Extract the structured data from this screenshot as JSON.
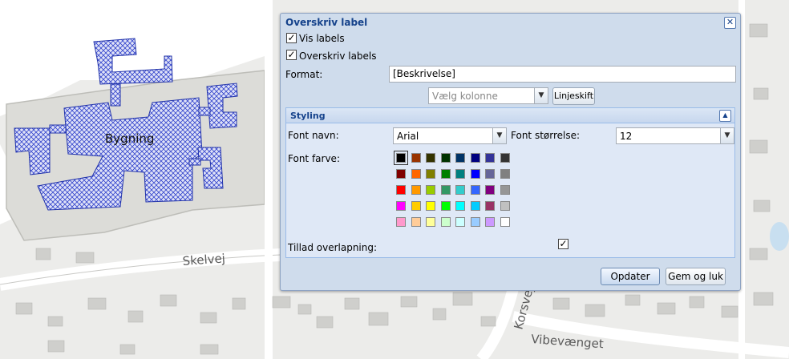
{
  "map": {
    "building_label": "Bygning",
    "roads": [
      "Skelvej",
      "Korsvej",
      "Vibevænget"
    ],
    "building_fill_color": "#3344cc"
  },
  "dialog": {
    "title": "Overskriv label",
    "close_icon": "close-icon",
    "show_labels": {
      "label": "Vis labels",
      "checked": true
    },
    "override_labels": {
      "label": "Overskriv labels",
      "checked": true
    },
    "format": {
      "label": "Format:",
      "value": "[Beskrivelse]"
    },
    "column_select": {
      "placeholder": "Vælg kolonne"
    },
    "linebreak_button": "Linjeskift",
    "styling": {
      "title": "Styling",
      "font_name": {
        "label": "Font navn:",
        "value": "Arial"
      },
      "font_size": {
        "label": "Font størrelse:",
        "value": "12"
      },
      "font_color": {
        "label": "Font farve:",
        "selected": "#000000",
        "palette": [
          [
            "#000000",
            "#993300",
            "#333300",
            "#003300",
            "#003366",
            "#000080",
            "#333399",
            "#333333"
          ],
          [
            "#800000",
            "#FF6600",
            "#808000",
            "#008000",
            "#008080",
            "#0000FF",
            "#666699",
            "#808080"
          ],
          [
            "#FF0000",
            "#FF9900",
            "#99CC00",
            "#339966",
            "#33CCCC",
            "#3366FF",
            "#800080",
            "#969696"
          ],
          [
            "#FF00FF",
            "#FFCC00",
            "#FFFF00",
            "#00FF00",
            "#00FFFF",
            "#00CCFF",
            "#993366",
            "#C0C0C0"
          ],
          [
            "#FF99CC",
            "#FFCC99",
            "#FFFF99",
            "#CCFFCC",
            "#CCFFFF",
            "#99CCFF",
            "#CC99FF",
            "#FFFFFF"
          ]
        ]
      },
      "allow_overlap": {
        "label": "Tillad overlapning:",
        "checked": true
      }
    },
    "update_button": "Opdater",
    "save_close_button": "Gem og luk"
  }
}
